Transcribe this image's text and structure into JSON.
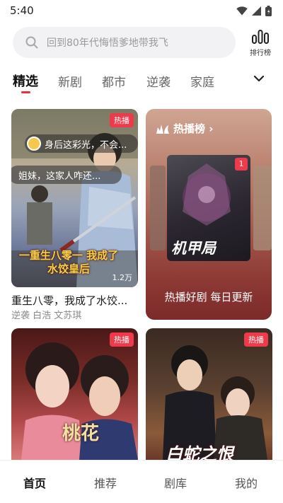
{
  "status_bar": {
    "time": "5:40"
  },
  "search": {
    "placeholder": "回到80年代悔悟爹地带我飞"
  },
  "ranking": {
    "label": "排行榜"
  },
  "tabs": [
    {
      "label": "精选",
      "active": true
    },
    {
      "label": "新剧"
    },
    {
      "label": "都市"
    },
    {
      "label": "逆袭"
    },
    {
      "label": "家庭"
    }
  ],
  "cards": {
    "featured": {
      "badge": "热播",
      "danmaku": [
        "身后这彩光，不会...",
        "姐妹，这家人咋还..."
      ],
      "poster_text": "一重生八零一 我成了水饺皇后",
      "play_count": "1.2万",
      "title": "重生八零，我成了水饺...",
      "tags": "逆袭 白浩 文苏琪"
    },
    "hot_list": {
      "heading": "热播榜 ›",
      "rank": "1",
      "poster_text": "机甲局",
      "footer": "热播好剧 每日更新"
    },
    "bottom_left": {
      "badge": "热播",
      "poster_text": "桃花"
    },
    "bottom_right": {
      "badge": "热播",
      "poster_text": "白蛇之恨"
    }
  },
  "bottom_nav": [
    {
      "label": "首页",
      "active": true
    },
    {
      "label": "推荐"
    },
    {
      "label": "剧库"
    },
    {
      "label": "我的"
    }
  ],
  "colors": {
    "accent": "#e8313a",
    "badge": "#ee3a4b",
    "hot_card_top": "#d0a593",
    "hot_card_bottom": "#7c2a2a"
  },
  "icons": [
    "wifi-icon",
    "signal-icon",
    "battery-icon",
    "search-icon",
    "bar-chart-icon",
    "chevron-down-icon",
    "flame-icon"
  ]
}
